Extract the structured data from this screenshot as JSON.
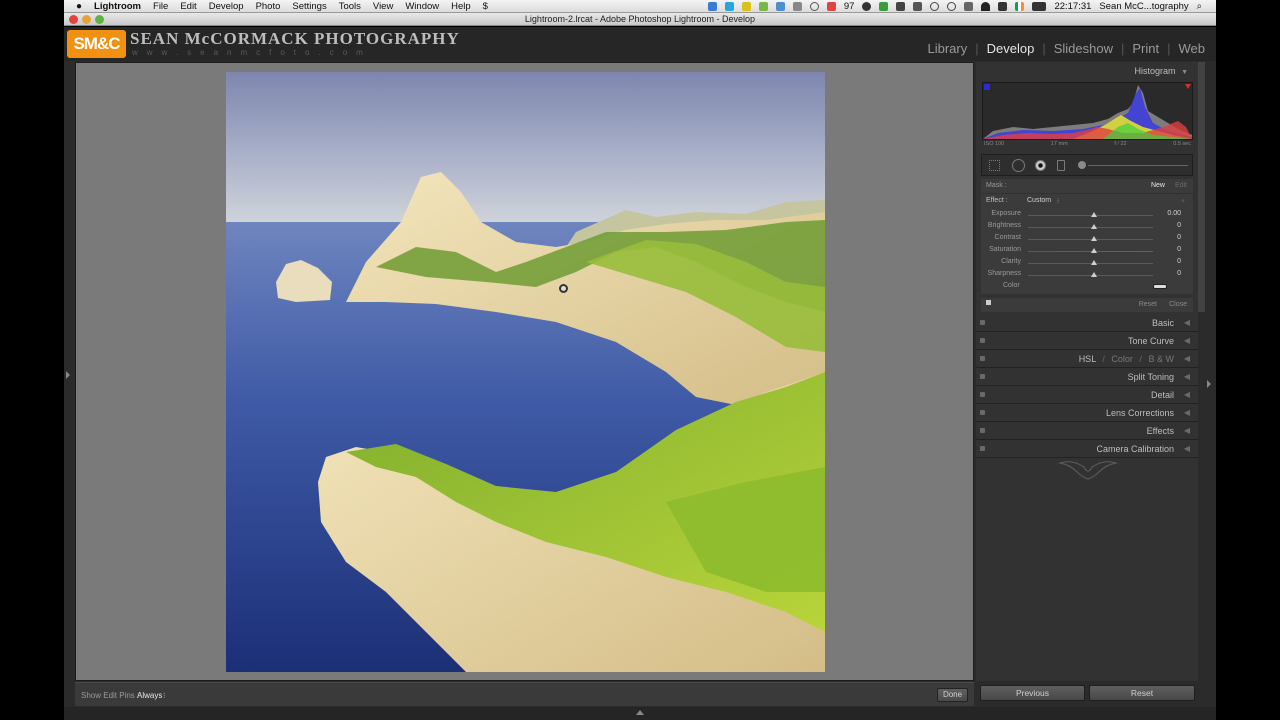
{
  "menubar": {
    "apple": "",
    "items": [
      "Lightroom",
      "File",
      "Edit",
      "Develop",
      "Photo",
      "Settings",
      "Tools",
      "View",
      "Window",
      "Help"
    ],
    "mail_count": "97",
    "time": "22:17:31",
    "user": "Sean McC...tography"
  },
  "window": {
    "title": "Lightroom-2.lrcat - Adobe Photoshop Lightroom - Develop"
  },
  "identity": {
    "logo": "SM&C",
    "name": "SEAN McCORMACK PHOTOGRAPHY",
    "url": "www.seanmcfoto.com"
  },
  "modules": {
    "items": [
      "Library",
      "Develop",
      "Slideshow",
      "Print",
      "Web"
    ],
    "active": "Develop"
  },
  "histogram": {
    "title": "Histogram",
    "iso": "ISO 100",
    "focal": "17 mm",
    "aperture": "f / 22",
    "shutter": "0.5 sec"
  },
  "mask": {
    "label": "Mask :",
    "new": "New",
    "edit": "Edit"
  },
  "effect": {
    "label": "Effect :",
    "preset": "Custom",
    "sliders": [
      {
        "name": "Exposure",
        "value": "0.00"
      },
      {
        "name": "Brightness",
        "value": "0"
      },
      {
        "name": "Contrast",
        "value": "0"
      },
      {
        "name": "Saturation",
        "value": "0"
      },
      {
        "name": "Clarity",
        "value": "0"
      },
      {
        "name": "Sharpness",
        "value": "0"
      }
    ],
    "color_label": "Color"
  },
  "tool_actions": {
    "reset": "Reset",
    "close": "Close"
  },
  "panels": {
    "basic": "Basic",
    "tone_curve": "Tone Curve",
    "hsl": "HSL",
    "hsl_sep": "/",
    "color": "Color",
    "bw": "B & W",
    "split_toning": "Split Toning",
    "detail": "Detail",
    "lens_corrections": "Lens Corrections",
    "effects": "Effects",
    "camera_calibration": "Camera Calibration"
  },
  "toolbar": {
    "show_pins_label": "Show Edit Pins :",
    "show_pins_value": "Always",
    "done": "Done"
  },
  "bottom": {
    "previous": "Previous",
    "reset": "Reset"
  },
  "colors": {
    "accent_orange": "#f29111",
    "panel": "#323232",
    "canvas": "#7a7a7a"
  }
}
